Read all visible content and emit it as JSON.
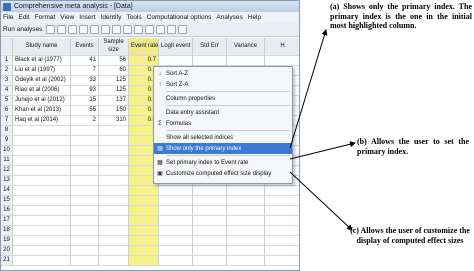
{
  "window": {
    "title": "Comprehensive meta analysis - [Data]"
  },
  "menubar": {
    "items": [
      "File",
      "Edit",
      "Format",
      "View",
      "Insert",
      "Identify",
      "Tools",
      "Computational options",
      "Analyses",
      "Help"
    ]
  },
  "toolbar": {
    "run_label": "Run analyses"
  },
  "grid": {
    "headers": [
      "",
      "Study name",
      "Events",
      "Sample size",
      "Event rate",
      "Logit event",
      "Std Err",
      "Variance",
      "H"
    ],
    "rows": [
      {
        "num": "1",
        "study": "Black et al (1977)",
        "events": "41",
        "sample": "56",
        "rate": "0.7"
      },
      {
        "num": "2",
        "study": "Liu et al (1997)",
        "events": "7",
        "sample": "60",
        "rate": "0.1"
      },
      {
        "num": "3",
        "study": "Gdeyik et al (2002)",
        "events": "33",
        "sample": "125",
        "rate": "0.2"
      },
      {
        "num": "4",
        "study": "Riao et al (2006)",
        "events": "93",
        "sample": "125",
        "rate": "0.7"
      },
      {
        "num": "5",
        "study": "Junejo et al (2012)",
        "events": "15",
        "sample": "137",
        "rate": "0.1"
      },
      {
        "num": "6",
        "study": "Khan et al (2013)",
        "events": "55",
        "sample": "150",
        "rate": "0.3"
      },
      {
        "num": "7",
        "study": "Haq et al (2014)",
        "events": "2",
        "sample": "310",
        "rate": "0.0"
      },
      {
        "num": "8",
        "study": "",
        "events": "",
        "sample": "",
        "rate": ""
      },
      {
        "num": "9",
        "study": "",
        "events": "",
        "sample": "",
        "rate": ""
      },
      {
        "num": "10",
        "study": "",
        "events": "",
        "sample": "",
        "rate": ""
      },
      {
        "num": "11",
        "study": "",
        "events": "",
        "sample": "",
        "rate": ""
      },
      {
        "num": "12",
        "study": "",
        "events": "",
        "sample": "",
        "rate": ""
      },
      {
        "num": "13",
        "study": "",
        "events": "",
        "sample": "",
        "rate": ""
      },
      {
        "num": "14",
        "study": "",
        "events": "",
        "sample": "",
        "rate": ""
      },
      {
        "num": "15",
        "study": "",
        "events": "",
        "sample": "",
        "rate": ""
      },
      {
        "num": "16",
        "study": "",
        "events": "",
        "sample": "",
        "rate": ""
      },
      {
        "num": "17",
        "study": "",
        "events": "",
        "sample": "",
        "rate": ""
      },
      {
        "num": "18",
        "study": "",
        "events": "",
        "sample": "",
        "rate": ""
      },
      {
        "num": "19",
        "study": "",
        "events": "",
        "sample": "",
        "rate": ""
      },
      {
        "num": "20",
        "study": "",
        "events": "",
        "sample": "",
        "rate": ""
      },
      {
        "num": "21",
        "study": "",
        "events": "",
        "sample": "",
        "rate": ""
      }
    ]
  },
  "context_menu": {
    "sort_az": "Sort A-Z",
    "sort_za": "Sort Z-A",
    "column_properties": "Column properties",
    "data_entry_assistant": "Data entry assistant",
    "formulas": "Formulas",
    "show_all": "Show all selected indices",
    "show_primary": "Show only the primary index",
    "set_primary": "Set primary index to Event rate",
    "customize": "Customize computed effect size display"
  },
  "annotations": {
    "a": "(a) Shows only the primary index. The primary index is the one in the initial most highlighted column.",
    "b": "(b) Allows the user to set the primary index.",
    "c": "(c) Allows the user of customize the display of computed effect sizes"
  },
  "colors": {
    "highlight": "#3d7ad6",
    "event_rate_column": "#f6f28a"
  }
}
